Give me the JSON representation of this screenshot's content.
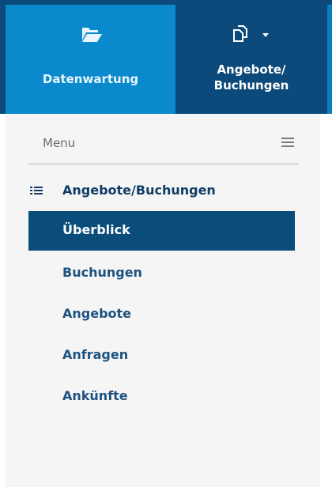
{
  "topbar": {
    "tabs": [
      {
        "label": "Datenwartung",
        "icon": "folder-open-icon"
      },
      {
        "label_line1": "Angebote/",
        "label_line2": "Buchungen",
        "icon": "copy-dropdown-icon"
      }
    ],
    "colors": {
      "active_tab": "#0a89cc",
      "dark": "#0b4a7a"
    }
  },
  "menu": {
    "title": "Menu",
    "section": {
      "label": "Angebote/Buchungen",
      "icon": "list-icon"
    },
    "items": [
      {
        "label": "Überblick",
        "active": true
      },
      {
        "label": "Buchungen"
      },
      {
        "label": "Angebote"
      },
      {
        "label": "Anfragen"
      },
      {
        "label": "Ankünfte"
      }
    ]
  }
}
